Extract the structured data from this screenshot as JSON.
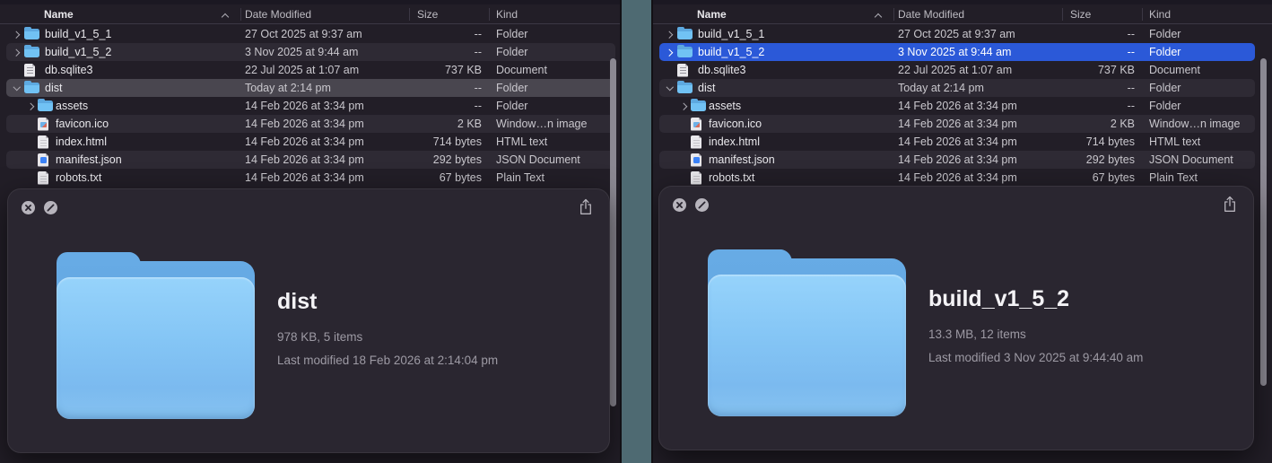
{
  "colors": {
    "desktop_teal": "#4e6a72",
    "window_background": "#221e27",
    "row_stripe": "#2e2a34",
    "selection_gray": "#49464f",
    "selection_blue": "#2b59d8",
    "folder_blue_front": "#84c5f5",
    "folder_blue_back": "#62a6e2"
  },
  "windows": [
    {
      "side": "left",
      "header": {
        "name": "Name",
        "date": "Date Modified",
        "size": "Size",
        "kind": "Kind",
        "sort_indicator": "chevron-up"
      },
      "rows": [
        {
          "name": "build_v1_5_1",
          "date": "27 Oct 2025 at 9:37 am",
          "size": "--",
          "kind": "Folder",
          "icon": "folder",
          "level": 0,
          "chevron": "right",
          "selected": null
        },
        {
          "name": "build_v1_5_2",
          "date": "3 Nov 2025 at 9:44 am",
          "size": "--",
          "kind": "Folder",
          "icon": "folder",
          "level": 0,
          "chevron": "right",
          "selected": null
        },
        {
          "name": "db.sqlite3",
          "date": "22 Jul 2025 at 1:07 am",
          "size": "737 KB",
          "kind": "Document",
          "icon": "doc-db",
          "level": 0,
          "chevron": null,
          "selected": null
        },
        {
          "name": "dist",
          "date": "Today at 2:14 pm",
          "size": "--",
          "kind": "Folder",
          "icon": "folder",
          "level": 0,
          "chevron": "down",
          "selected": "gray"
        },
        {
          "name": "assets",
          "date": "14 Feb 2026 at 3:34 pm",
          "size": "--",
          "kind": "Folder",
          "icon": "folder",
          "level": 1,
          "chevron": "right",
          "selected": null
        },
        {
          "name": "favicon.ico",
          "date": "14 Feb 2026 at 3:34 pm",
          "size": "2 KB",
          "kind": "Window…n image",
          "icon": "doc-image",
          "level": 1,
          "chevron": null,
          "selected": null
        },
        {
          "name": "index.html",
          "date": "14 Feb 2026 at 3:34 pm",
          "size": "714 bytes",
          "kind": "HTML text",
          "icon": "doc-html",
          "level": 1,
          "chevron": null,
          "selected": null
        },
        {
          "name": "manifest.json",
          "date": "14 Feb 2026 at 3:34 pm",
          "size": "292 bytes",
          "kind": "JSON Document",
          "icon": "doc-json",
          "level": 1,
          "chevron": null,
          "selected": null
        },
        {
          "name": "robots.txt",
          "date": "14 Feb 2026 at 3:34 pm",
          "size": "67 bytes",
          "kind": "Plain Text",
          "icon": "doc-txt",
          "level": 1,
          "chevron": null,
          "selected": null
        }
      ],
      "quicklook": {
        "title": "dist",
        "meta": "978 KB, 5 items",
        "modified": "Last modified 18 Feb 2026 at 2:14:04 pm",
        "toolbar_icons": [
          "circle-x-icon",
          "circle-slash-icon",
          "share-icon"
        ]
      }
    },
    {
      "side": "right",
      "header": {
        "name": "Name",
        "date": "Date Modified",
        "size": "Size",
        "kind": "Kind",
        "sort_indicator": "chevron-up"
      },
      "rows": [
        {
          "name": "build_v1_5_1",
          "date": "27 Oct 2025 at 9:37 am",
          "size": "--",
          "kind": "Folder",
          "icon": "folder",
          "level": 0,
          "chevron": "right",
          "selected": null
        },
        {
          "name": "build_v1_5_2",
          "date": "3 Nov 2025 at 9:44 am",
          "size": "--",
          "kind": "Folder",
          "icon": "folder",
          "level": 0,
          "chevron": "right",
          "selected": "blue"
        },
        {
          "name": "db.sqlite3",
          "date": "22 Jul 2025 at 1:07 am",
          "size": "737 KB",
          "kind": "Document",
          "icon": "doc-db",
          "level": 0,
          "chevron": null,
          "selected": null
        },
        {
          "name": "dist",
          "date": "Today at 2:14 pm",
          "size": "--",
          "kind": "Folder",
          "icon": "folder",
          "level": 0,
          "chevron": "down",
          "selected": null
        },
        {
          "name": "assets",
          "date": "14 Feb 2026 at 3:34 pm",
          "size": "--",
          "kind": "Folder",
          "icon": "folder",
          "level": 1,
          "chevron": "right",
          "selected": null
        },
        {
          "name": "favicon.ico",
          "date": "14 Feb 2026 at 3:34 pm",
          "size": "2 KB",
          "kind": "Window…n image",
          "icon": "doc-image",
          "level": 1,
          "chevron": null,
          "selected": null
        },
        {
          "name": "index.html",
          "date": "14 Feb 2026 at 3:34 pm",
          "size": "714 bytes",
          "kind": "HTML text",
          "icon": "doc-html",
          "level": 1,
          "chevron": null,
          "selected": null
        },
        {
          "name": "manifest.json",
          "date": "14 Feb 2026 at 3:34 pm",
          "size": "292 bytes",
          "kind": "JSON Document",
          "icon": "doc-json",
          "level": 1,
          "chevron": null,
          "selected": null
        },
        {
          "name": "robots.txt",
          "date": "14 Feb 2026 at 3:34 pm",
          "size": "67 bytes",
          "kind": "Plain Text",
          "icon": "doc-txt",
          "level": 1,
          "chevron": null,
          "selected": null
        }
      ],
      "quicklook": {
        "title": "build_v1_5_2",
        "meta": "13.3 MB, 12 items",
        "modified": "Last modified 3 Nov 2025 at 9:44:40 am",
        "toolbar_icons": [
          "circle-x-icon",
          "circle-slash-icon",
          "share-icon"
        ]
      }
    }
  ]
}
